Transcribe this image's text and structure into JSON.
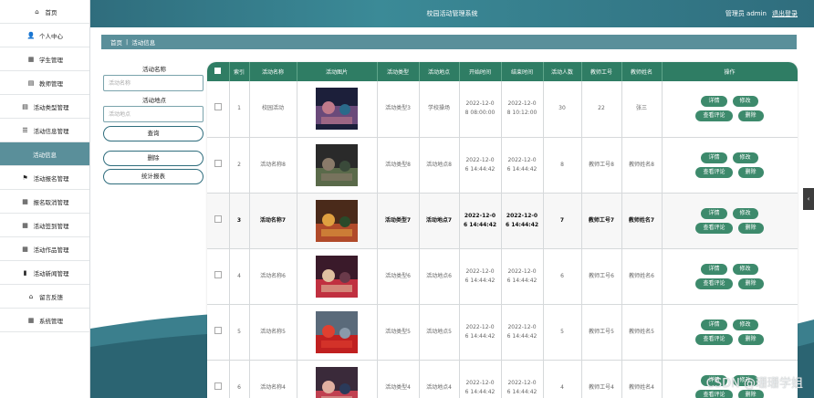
{
  "sidebar": {
    "items": [
      {
        "label": "首页",
        "icon": "home-icon",
        "glyph": "⌂"
      },
      {
        "label": "个人中心",
        "icon": "user-icon",
        "glyph": "👤"
      },
      {
        "label": "学生管理",
        "icon": "grid-icon",
        "glyph": "▦"
      },
      {
        "label": "教师管理",
        "icon": "doc-icon",
        "glyph": "▤"
      },
      {
        "label": "活动类型管理",
        "icon": "doc-icon",
        "glyph": "▤"
      },
      {
        "label": "活动信息管理",
        "icon": "sliders-icon",
        "glyph": "☰"
      },
      {
        "label": "活动信息",
        "icon": "",
        "glyph": ""
      },
      {
        "label": "活动报名管理",
        "icon": "flag-icon",
        "glyph": "⚑"
      },
      {
        "label": "报名取消管理",
        "icon": "grid-icon",
        "glyph": "▦"
      },
      {
        "label": "活动签到管理",
        "icon": "grid-icon",
        "glyph": "▦"
      },
      {
        "label": "活动作品管理",
        "icon": "grid-icon",
        "glyph": "▦"
      },
      {
        "label": "活动新闻管理",
        "icon": "bar-chart-icon",
        "glyph": "▮"
      },
      {
        "label": "留言反馈",
        "icon": "house-icon",
        "glyph": "⌂"
      },
      {
        "label": "系统管理",
        "icon": "grid-icon",
        "glyph": "▦"
      }
    ],
    "active_index": 6
  },
  "topbar": {
    "title": "校园活动管理系统",
    "admin_text": "管理员 admin",
    "logout_label": "退出登录"
  },
  "breadcrumb": {
    "home": "首页",
    "separator": "|",
    "current": "活动信息"
  },
  "search": {
    "name_label": "活动名称",
    "name_placeholder": "活动名称",
    "place_label": "活动地点",
    "place_placeholder": "活动地点",
    "query_button": "查询",
    "delete_button": "删除",
    "report_button": "统计报表"
  },
  "table": {
    "columns": [
      "索引",
      "活动名称",
      "活动图片",
      "活动类型",
      "活动地点",
      "开始时间",
      "结束时间",
      "活动人数",
      "教师工号",
      "教师姓名",
      "操作"
    ],
    "rows": [
      {
        "index": "1",
        "name": "校园活动",
        "type": "活动类型3",
        "place": "学校操场",
        "start": "2022-12-0\n8 08:00:00",
        "end": "2022-12-0\n8 10:12:00",
        "count": "30",
        "teacher_no": "22",
        "teacher_name": "张三",
        "bold": false
      },
      {
        "index": "2",
        "name": "活动名称8",
        "type": "活动类型8",
        "place": "活动地点8",
        "start": "2022-12-0\n6 14:44:42",
        "end": "2022-12-0\n6 14:44:42",
        "count": "8",
        "teacher_no": "教师工号8",
        "teacher_name": "教师姓名8",
        "bold": false
      },
      {
        "index": "3",
        "name": "活动名称7",
        "type": "活动类型7",
        "place": "活动地点7",
        "start": "2022-12-0\n6 14:44:42",
        "end": "2022-12-0\n6 14:44:42",
        "count": "7",
        "teacher_no": "教师工号7",
        "teacher_name": "教师姓名7",
        "bold": true
      },
      {
        "index": "4",
        "name": "活动名称6",
        "type": "活动类型6",
        "place": "活动地点6",
        "start": "2022-12-0\n6 14:44:42",
        "end": "2022-12-0\n6 14:44:42",
        "count": "6",
        "teacher_no": "教师工号6",
        "teacher_name": "教师姓名6",
        "bold": false
      },
      {
        "index": "5",
        "name": "活动名称5",
        "type": "活动类型5",
        "place": "活动地点5",
        "start": "2022-12-0\n6 14:44:42",
        "end": "2022-12-0\n6 14:44:42",
        "count": "5",
        "teacher_no": "教师工号5",
        "teacher_name": "教师姓名5",
        "bold": false
      },
      {
        "index": "6",
        "name": "活动名称4",
        "type": "活动类型4",
        "place": "活动地点4",
        "start": "2022-12-0\n6 14:44:42",
        "end": "2022-12-0\n6 14:44:42",
        "count": "4",
        "teacher_no": "教师工号4",
        "teacher_name": "教师姓名4",
        "bold": false
      }
    ],
    "actions": {
      "detail": "详情",
      "edit": "修改",
      "comments": "查看评论",
      "delete": "删除"
    }
  },
  "watermark": "CSDN @珊珊学姐",
  "colors": {
    "topbar": "#2f6d7d",
    "table_header": "#2f7d64",
    "action_button": "#3d8a6c",
    "sidebar_active": "#5a8f9a"
  }
}
